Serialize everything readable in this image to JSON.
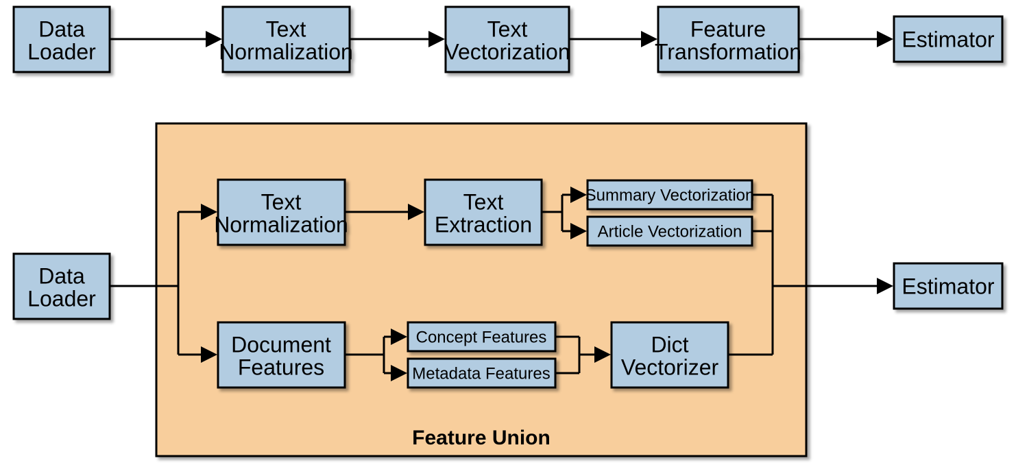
{
  "top_row": {
    "data_loader_1": "Data",
    "data_loader_2": "Loader",
    "text_norm_1": "Text",
    "text_norm_2": "Normalization",
    "text_vect_1": "Text",
    "text_vect_2": "Vectorization",
    "feat_xform_1": "Feature",
    "feat_xform_2": "Transformation",
    "estimator": "Estimator"
  },
  "bottom": {
    "data_loader_1": "Data",
    "data_loader_2": "Loader",
    "text_norm_1": "Text",
    "text_norm_2": "Normalization",
    "text_extract_1": "Text",
    "text_extract_2": "Extraction",
    "summary_vect": "Summary Vectorization",
    "article_vect": "Article Vectorization",
    "doc_feat_1": "Document",
    "doc_feat_2": "Features",
    "concept_feat": "Concept Features",
    "metadata_feat": "Metadata Features",
    "dict_vect_1": "Dict",
    "dict_vect_2": "Vectorizer",
    "estimator": "Estimator",
    "caption": "Feature Union"
  }
}
